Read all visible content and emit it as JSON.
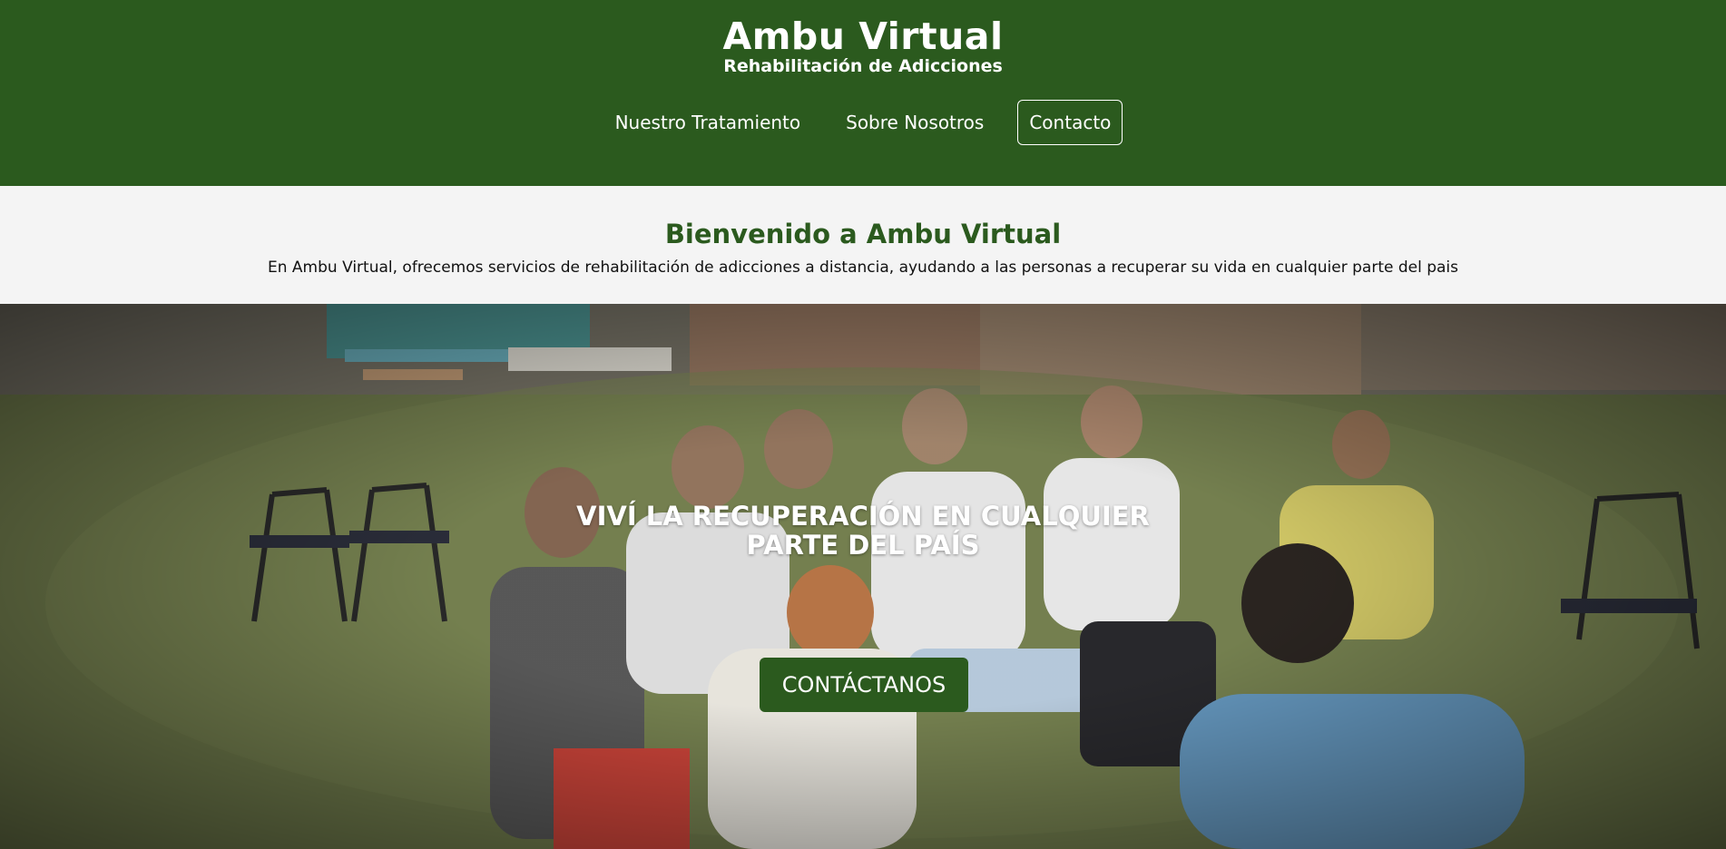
{
  "brand": {
    "title": "Ambu Virtual",
    "subtitle": "Rehabilitación de Adicciones"
  },
  "nav": {
    "items": [
      {
        "label": "Nuestro Tratamiento"
      },
      {
        "label": "Sobre Nosotros"
      },
      {
        "label": "Contacto"
      }
    ]
  },
  "welcome": {
    "title": "Bienvenido a Ambu Virtual",
    "text": "En Ambu Virtual, ofrecemos servicios de rehabilitación de adicciones a distancia, ayudando a las personas a recuperar su vida en cualquier parte del pais"
  },
  "hero": {
    "heading_line1": "VIVÍ LA RECUPERACIÓN EN CUALQUIER",
    "heading_line2": "PARTE DEL PAÍS",
    "cta_label": "CONTÁCTANOS"
  },
  "colors": {
    "brand_green": "#2b5a1e",
    "light_background": "#f4f4f4"
  }
}
